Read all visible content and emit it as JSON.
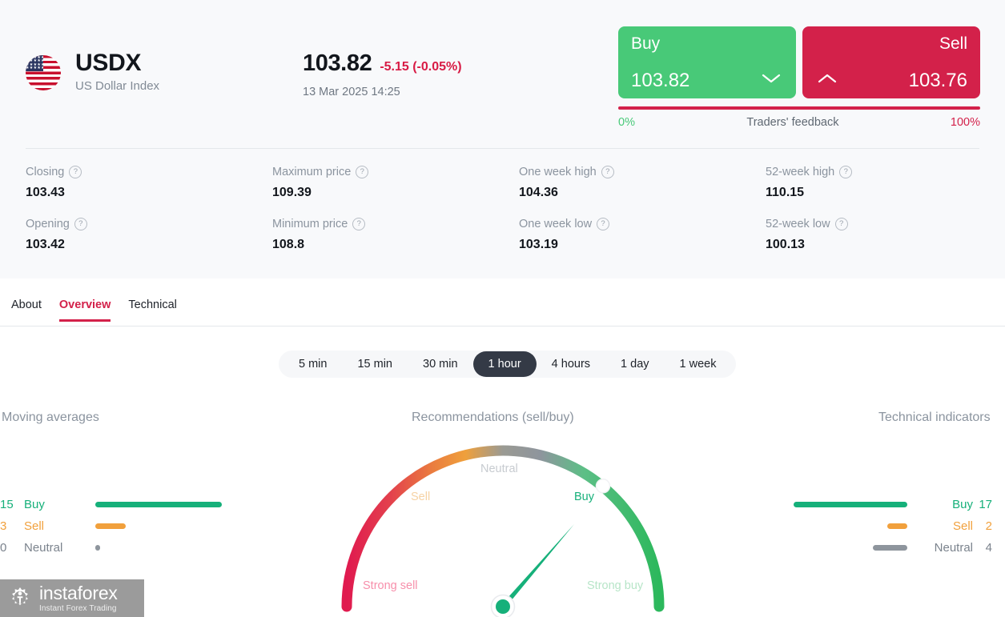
{
  "instrument": {
    "flag_icon": "us-flag-icon",
    "ticker": "USDX",
    "name": "US Dollar Index"
  },
  "quote": {
    "last": "103.82",
    "change": "-5.15 (-0.05%)",
    "timestamp": "13 Mar 2025 14:25",
    "change_color": "#d81b45"
  },
  "trade": {
    "buy_label": "Buy",
    "buy_price": "103.82",
    "buy_color": "#48c978",
    "buy_chevron_icon": "chevron-down-icon",
    "sell_label": "Sell",
    "sell_price": "103.76",
    "sell_color": "#d3214a",
    "sell_chevron_icon": "chevron-up-icon",
    "feedback_title": "Traders' feedback",
    "feedback_left": "0%",
    "feedback_right": "100%"
  },
  "stats": [
    {
      "label": "Closing",
      "value": "103.43",
      "help_icon": "question-mark-icon"
    },
    {
      "label": "Maximum price",
      "value": "109.39",
      "help_icon": "question-mark-icon"
    },
    {
      "label": "One week high",
      "value": "104.36",
      "help_icon": "question-mark-icon"
    },
    {
      "label": "52-week high",
      "value": "110.15",
      "help_icon": "question-mark-icon"
    },
    {
      "label": "Opening",
      "value": "103.42",
      "help_icon": "question-mark-icon"
    },
    {
      "label": "Minimum price",
      "value": "108.8",
      "help_icon": "question-mark-icon"
    },
    {
      "label": "One week low",
      "value": "103.19",
      "help_icon": "question-mark-icon"
    },
    {
      "label": "52-week low",
      "value": "100.13",
      "help_icon": "question-mark-icon"
    }
  ],
  "tabs": [
    {
      "label": "About",
      "active": false
    },
    {
      "label": "Overview",
      "active": true
    },
    {
      "label": "Technical",
      "active": false
    }
  ],
  "timeframes": [
    {
      "label": "5 min",
      "active": false
    },
    {
      "label": "15 min",
      "active": false
    },
    {
      "label": "30 min",
      "active": false
    },
    {
      "label": "1 hour",
      "active": true
    },
    {
      "label": "4 hours",
      "active": false
    },
    {
      "label": "1 day",
      "active": false
    },
    {
      "label": "1 week",
      "active": false
    }
  ],
  "moving_averages": {
    "title": "Moving averages",
    "rows": [
      {
        "count": "15",
        "label": "Buy",
        "kind": "buy"
      },
      {
        "count": "3",
        "label": "Sell",
        "kind": "sell"
      },
      {
        "count": "0",
        "label": "Neutral",
        "kind": "neutral"
      }
    ]
  },
  "technical_indicators": {
    "title": "Technical indicators",
    "rows": [
      {
        "count": "17",
        "label": "Buy",
        "kind": "buy"
      },
      {
        "count": "2",
        "label": "Sell",
        "kind": "sell"
      },
      {
        "count": "4",
        "label": "Neutral",
        "kind": "neutral"
      }
    ]
  },
  "recommendations": {
    "title": "Recommendations (sell/buy)",
    "zones": [
      {
        "label": "Strong sell",
        "color": "#f78fab",
        "active": false
      },
      {
        "label": "Sell",
        "color": "#f6d2a4",
        "active": false
      },
      {
        "label": "Neutral",
        "color": "#c7cbd0",
        "active": false
      },
      {
        "label": "Buy",
        "color": "#16b07a",
        "active": true
      },
      {
        "label": "Strong buy",
        "color": "#b7e5c8",
        "active": false
      }
    ]
  },
  "chart_data": {
    "type": "gauge",
    "title": "Recommendations (sell/buy)",
    "zones": [
      "Strong sell",
      "Sell",
      "Neutral",
      "Buy",
      "Strong buy"
    ],
    "value": "Buy",
    "needle_fraction": 0.72,
    "marker_fraction": 0.79,
    "arc_start_color": "#e01a4f",
    "arc_mid_color": "#8e959d",
    "arc_end_color": "#2cb85c",
    "needle_color": "#16b07a",
    "companion_series": [
      {
        "name": "Moving averages",
        "categories": [
          "Buy",
          "Sell",
          "Neutral"
        ],
        "values": [
          15,
          3,
          0
        ]
      },
      {
        "name": "Technical indicators",
        "categories": [
          "Buy",
          "Sell",
          "Neutral"
        ],
        "values": [
          17,
          2,
          4
        ]
      }
    ]
  },
  "logo": {
    "name": "instaforex",
    "tagline": "Instant Forex Trading",
    "icon": "instaforex-gear-icon"
  }
}
